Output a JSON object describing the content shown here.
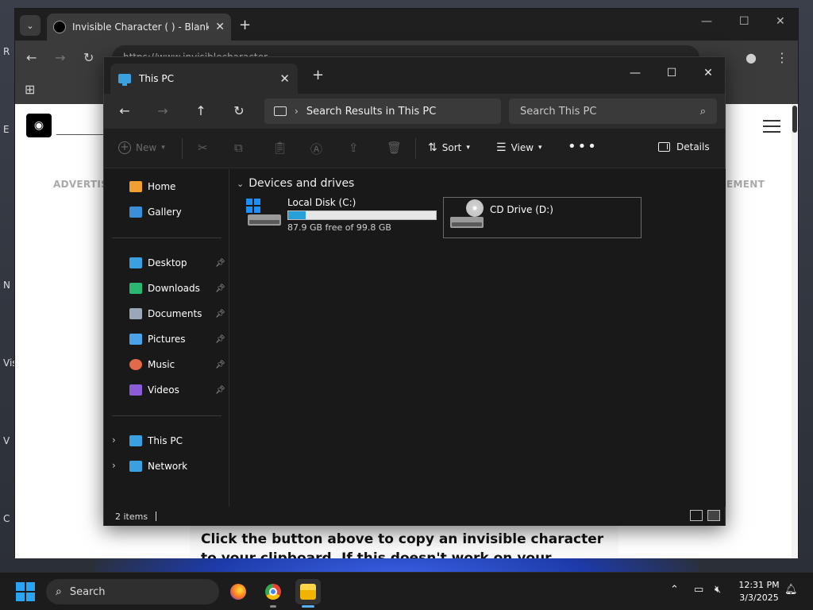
{
  "desktop": {
    "edge_labels": [
      "R",
      "E",
      "N",
      "Vis",
      "V",
      "C"
    ]
  },
  "browser": {
    "tab_title": "Invisible Character (  ) - Blank Y",
    "address_partial": "https://www.invisiblecharacter...",
    "site": {
      "ad_left": "ADVERTISE",
      "ad_right": "EMENT",
      "body_text": "Click the button above to copy an invisible character to your clipboard. If this doesn't work on your device, use"
    }
  },
  "explorer": {
    "tab_title": "This PC",
    "address_text": "Search Results in This PC",
    "search_placeholder": "Search This PC",
    "commands": {
      "new_label": "New",
      "sort_label": "Sort",
      "view_label": "View",
      "details_label": "Details"
    },
    "sidebar": {
      "top": [
        {
          "label": "Home",
          "color": "#f0a030"
        },
        {
          "label": "Gallery",
          "color": "#3a8fd8"
        }
      ],
      "pinned": [
        {
          "label": "Desktop",
          "color": "#3aa0e0"
        },
        {
          "label": "Downloads",
          "color": "#2bb673"
        },
        {
          "label": "Documents",
          "color": "#9aa7b8"
        },
        {
          "label": "Pictures",
          "color": "#4aa3e8"
        },
        {
          "label": "Music",
          "color": "#e06a4a"
        },
        {
          "label": "Videos",
          "color": "#8a5cd8"
        }
      ],
      "tree": [
        {
          "label": "This PC",
          "color": "#3aa0e0"
        },
        {
          "label": "Network",
          "color": "#3aa0e0"
        }
      ]
    },
    "group_header": "Devices and drives",
    "drives": [
      {
        "name": "Local Disk (C:)",
        "free_text": "87.9 GB free of 99.8 GB",
        "used_fraction": 0.119
      },
      {
        "name": "CD Drive (D:)"
      }
    ],
    "status": {
      "items": "2 items"
    }
  },
  "taskbar": {
    "search_label": "Search",
    "time": "12:31 PM",
    "date": "3/3/2025"
  }
}
